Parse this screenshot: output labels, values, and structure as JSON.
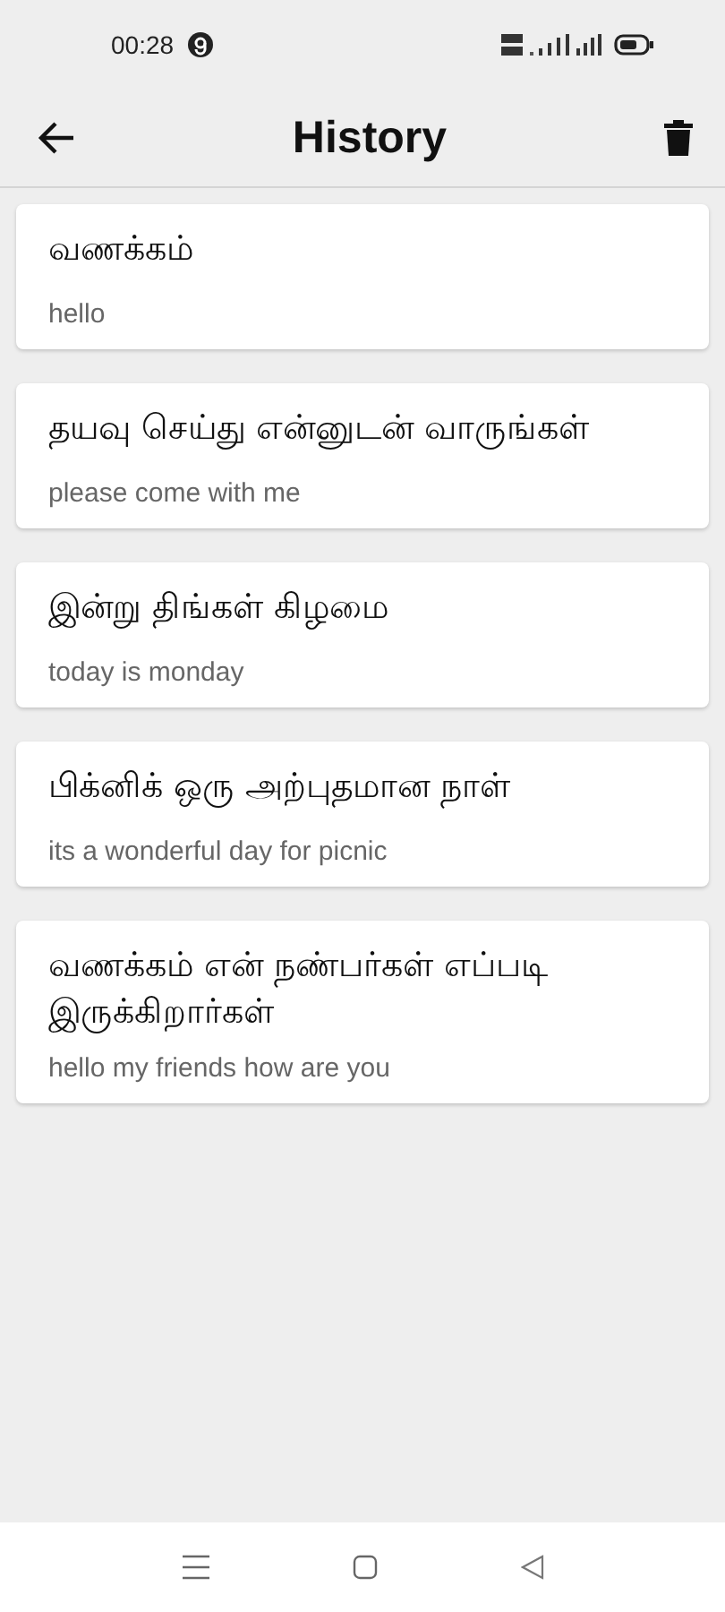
{
  "status_bar": {
    "time": "00:28"
  },
  "app_bar": {
    "title": "History"
  },
  "history": [
    {
      "tamil": "வணக்கம்",
      "english": "hello"
    },
    {
      "tamil": "தயவு செய்து என்னுடன் வாருங்கள்",
      "english": "please come with me"
    },
    {
      "tamil": "இன்று திங்கள் கிழமை",
      "english": "today is monday"
    },
    {
      "tamil": "பிக்னிக் ஒரு அற்புதமான நாள்",
      "english": "its a wonderful day for picnic"
    },
    {
      "tamil": "வணக்கம் என் நண்பர்கள் எப்படி இருக்கிறார்கள்",
      "english": "hello my friends how are you"
    }
  ]
}
